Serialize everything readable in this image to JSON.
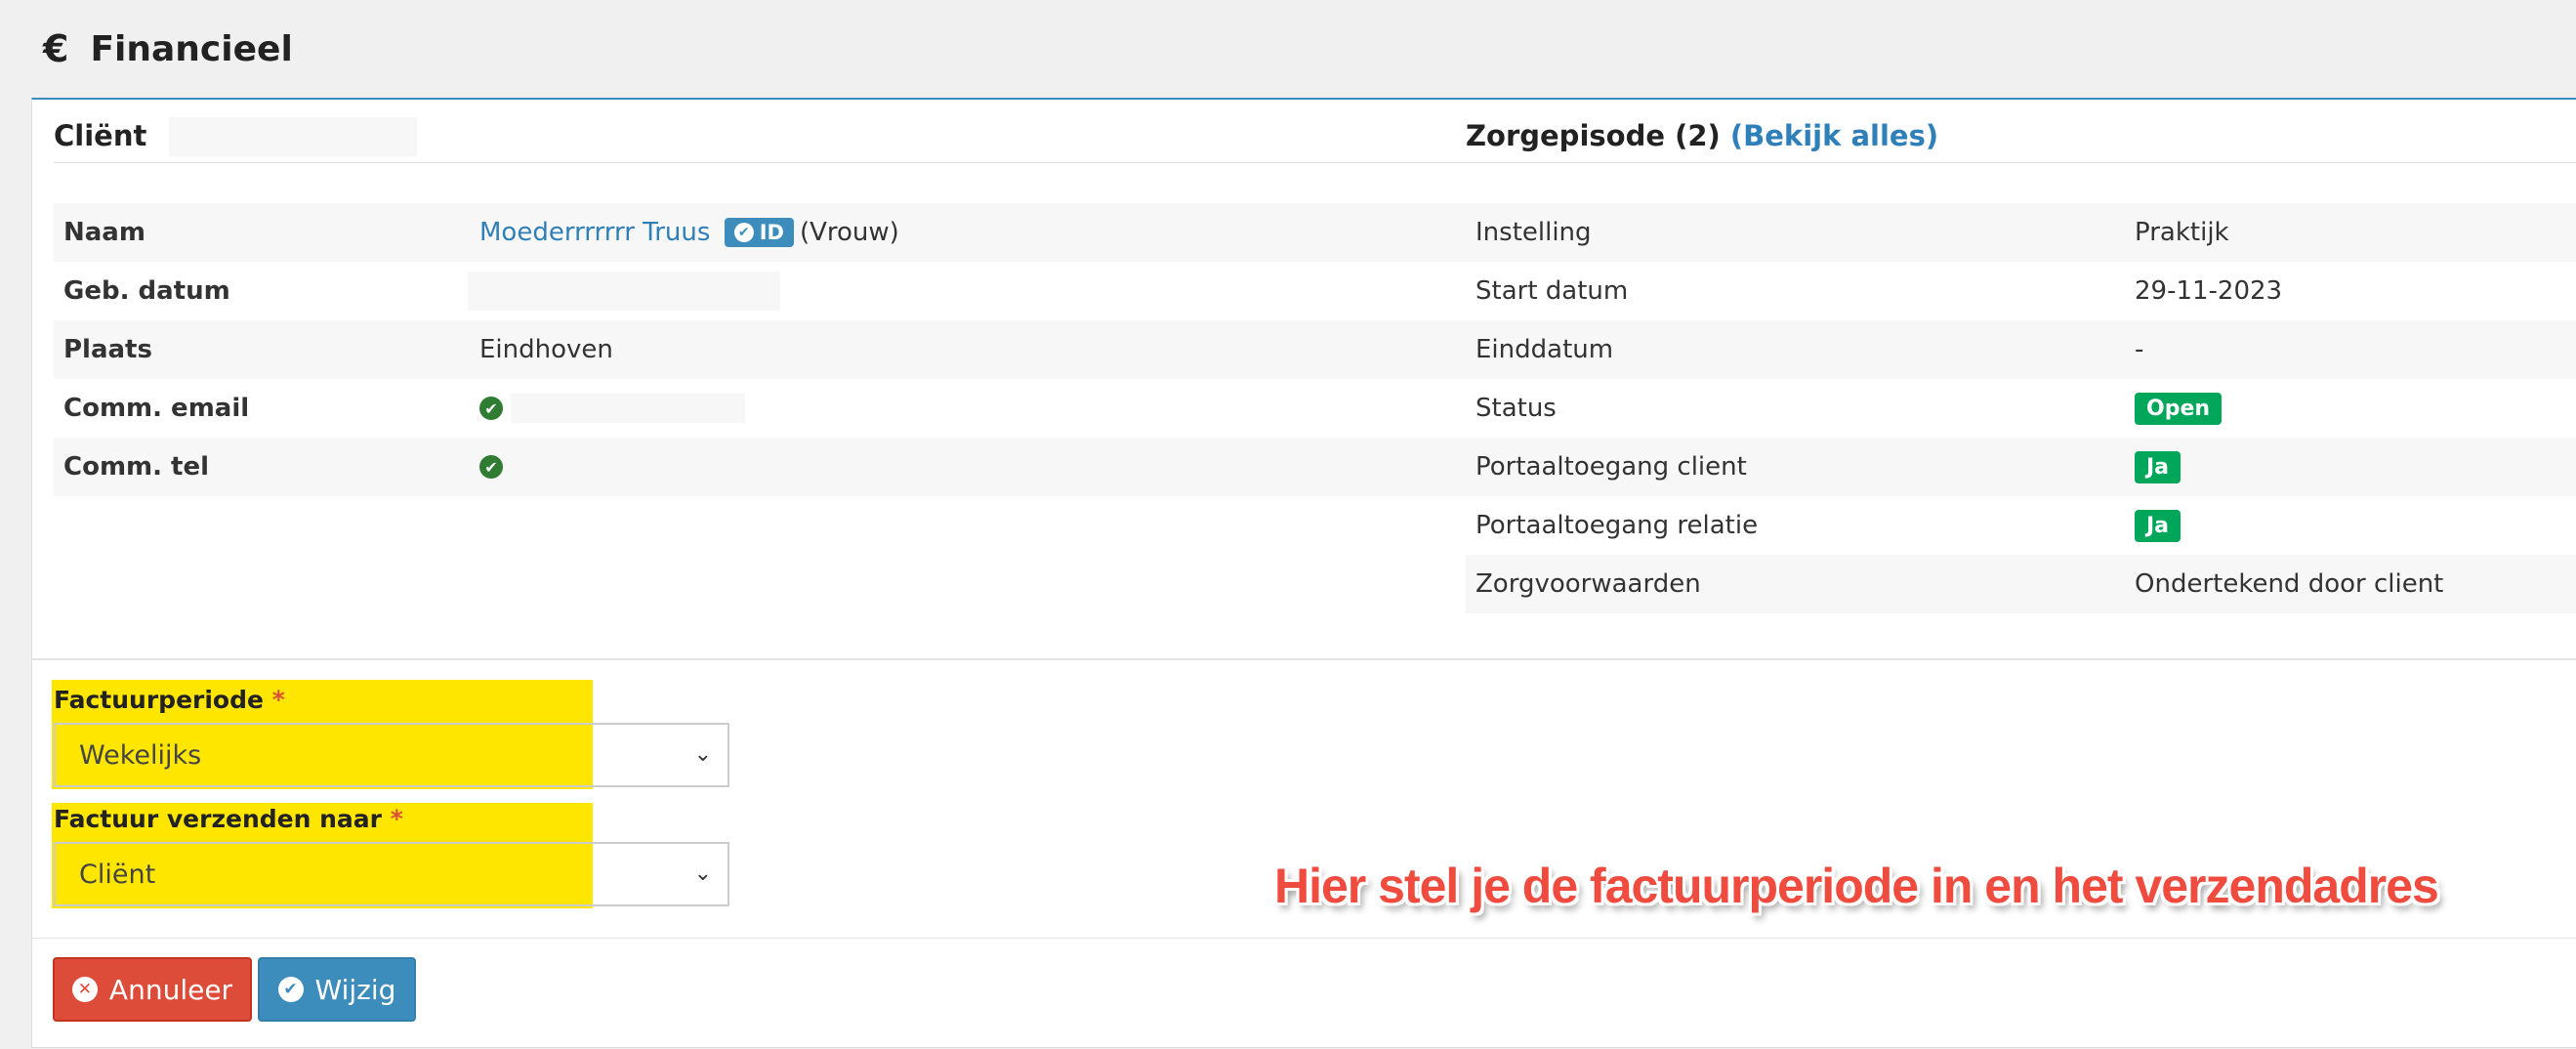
{
  "header": {
    "icon": "euro-icon",
    "icon_glyph": "€",
    "title": "Financieel"
  },
  "client": {
    "title": "Cliënt",
    "rows": {
      "name": {
        "label": "Naam",
        "value": "Moederrrrrrr Truus",
        "id_badge": "ID",
        "gender": "(Vrouw)"
      },
      "birthdate": {
        "label": "Geb. datum",
        "value": ""
      },
      "place": {
        "label": "Plaats",
        "value": "Eindhoven"
      },
      "email": {
        "label": "Comm. email",
        "value": ""
      },
      "phone": {
        "label": "Comm. tel",
        "value": ""
      }
    }
  },
  "episode": {
    "title": "Zorgepisode (2)",
    "link": "(Bekijk alles)",
    "rows": {
      "institution": {
        "label": "Instelling",
        "value": "Praktijk"
      },
      "start": {
        "label": "Start datum",
        "value": "29-11-2023"
      },
      "end": {
        "label": "Einddatum",
        "value": "-"
      },
      "status": {
        "label": "Status",
        "value": "Open"
      },
      "portal_client": {
        "label": "Portaaltoegang client",
        "value": "Ja"
      },
      "portal_relation": {
        "label": "Portaaltoegang relatie",
        "value": "Ja"
      },
      "conditions": {
        "label": "Zorgvoorwaarden",
        "value": "Ondertekend door client"
      }
    }
  },
  "form": {
    "period": {
      "label": "Factuurperiode",
      "required": "*",
      "value": "Wekelijks"
    },
    "send_to": {
      "label": "Factuur verzenden naar",
      "required": "*",
      "value": "Cliënt"
    }
  },
  "annotation": "Hier stel je de factuurperiode in en het verzendadres",
  "buttons": {
    "cancel": "Annuleer",
    "save": "Wijzig"
  },
  "colors": {
    "primary": "#3c8dbc",
    "danger": "#dd4b39",
    "success": "#00a65a",
    "highlight": "#ffe600",
    "annotation": "#ef4b3f"
  }
}
